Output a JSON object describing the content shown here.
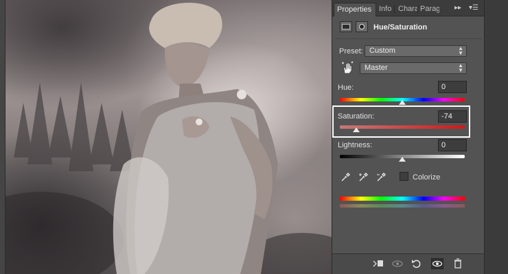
{
  "tabs": [
    {
      "label": "Properties"
    },
    {
      "label": "Info"
    },
    {
      "label": "Chara"
    },
    {
      "label": "Parag"
    }
  ],
  "tab_controls": {
    "expand": "▸▸",
    "menu": "▾☰"
  },
  "panel": {
    "title": "Hue/Saturation",
    "preset_label": "Preset:",
    "preset_value": "Custom",
    "channel_value": "Master",
    "hue_label": "Hue:",
    "hue_value": "0",
    "hue_level": 0.5,
    "saturation_label": "Saturation:",
    "saturation_value": "-74",
    "saturation_level": 0.13,
    "lightness_label": "Lightness:",
    "lightness_value": "0",
    "lightness_level": 0.5,
    "colorize_label": "Colorize",
    "colorize_checked": false
  },
  "bottom_icons": [
    "clip-to-layer-icon",
    "view-previous-state-icon",
    "reset-icon",
    "visibility-eye-icon",
    "trash-icon"
  ],
  "colors": {
    "panel_bg": "#535353",
    "highlight": "#ffffff",
    "saturation_track": "#d11818"
  }
}
